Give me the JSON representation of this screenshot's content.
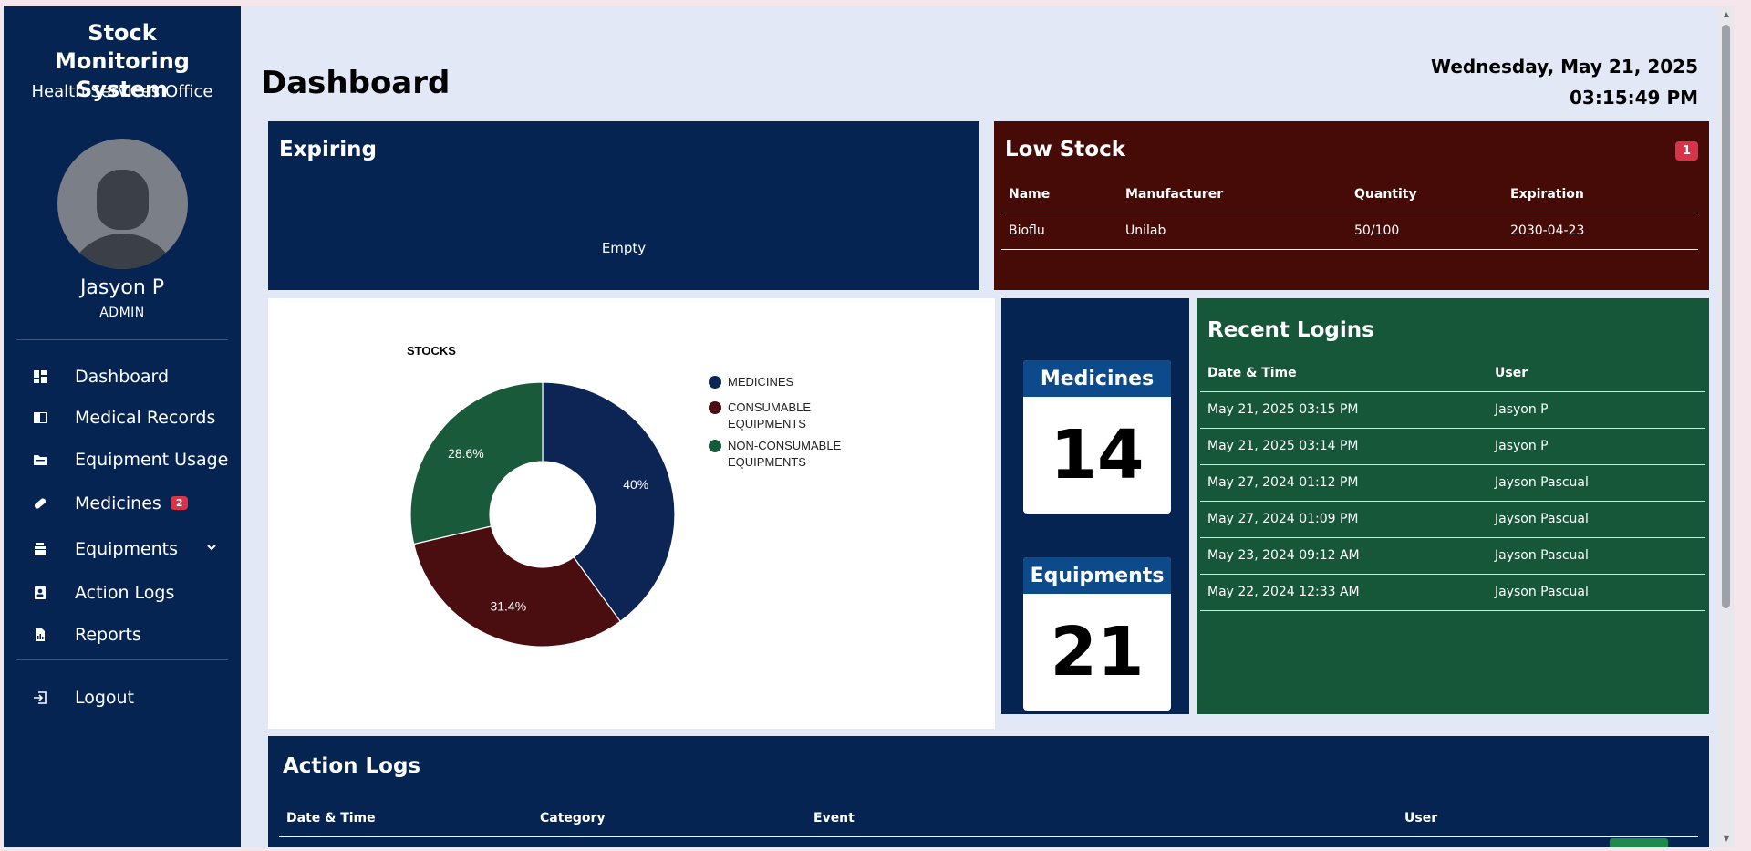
{
  "sidebar": {
    "title": "Stock Monitoring System",
    "subtitle": "Health Services Office",
    "user_name": "Jasyon P",
    "user_role": "ADMIN",
    "nav": [
      {
        "label": "Dashboard",
        "icon": "grid-icon"
      },
      {
        "label": "Medical Records",
        "icon": "book-icon"
      },
      {
        "label": "Equipment Usage",
        "icon": "folder-icon"
      },
      {
        "label": "Medicines",
        "icon": "pill-icon",
        "badge": "2"
      },
      {
        "label": "Equipments",
        "icon": "stack-icon"
      },
      {
        "label": "Action Logs",
        "icon": "contact-card-icon"
      },
      {
        "label": "Reports",
        "icon": "report-icon"
      },
      {
        "label": "Logout",
        "icon": "logout-icon"
      }
    ]
  },
  "header": {
    "title": "Dashboard",
    "date": "Wednesday, May 21, 2025",
    "time": "03:15:49 PM"
  },
  "expiring": {
    "title": "Expiring",
    "empty_text": "Empty"
  },
  "low_stock": {
    "title": "Low Stock",
    "count": "1",
    "columns": [
      "Name",
      "Manufacturer",
      "Quantity",
      "Expiration"
    ],
    "rows": [
      [
        "Bioflu",
        "Unilab",
        "50/100",
        "2030-04-23"
      ]
    ]
  },
  "stats": {
    "medicines_label": "Medicines",
    "medicines_count": "14",
    "equipments_label": "Equipments",
    "equipments_count": "21"
  },
  "recent_logins": {
    "title": "Recent Logins",
    "columns": [
      "Date & Time",
      "User"
    ],
    "rows": [
      [
        "May 21, 2025 03:15 PM",
        "Jasyon P"
      ],
      [
        "May 21, 2025 03:14 PM",
        "Jasyon P"
      ],
      [
        "May 27, 2024 01:12 PM",
        "Jayson Pascual"
      ],
      [
        "May 27, 2024 01:09 PM",
        "Jayson Pascual"
      ],
      [
        "May 23, 2024 09:12 AM",
        "Jayson Pascual"
      ],
      [
        "May 22, 2024 12:33 AM",
        "Jayson Pascual"
      ]
    ]
  },
  "action_logs": {
    "title": "Action Logs",
    "columns": [
      "Date & Time",
      "Category",
      "Event",
      "User"
    ]
  },
  "colors": {
    "navy": "#062451",
    "maroon": "#460a07",
    "green": "#16573a",
    "accent_blue": "#0c4a8c",
    "badge_red": "#d9334a"
  },
  "chart_data": {
    "type": "pie",
    "title": "STOCKS",
    "donut": true,
    "legend_position": "right",
    "slices": [
      {
        "label": "MEDICINES",
        "value": 40,
        "display": "40%",
        "color": "#0d2554"
      },
      {
        "label": "CONSUMABLE EQUIPMENTS",
        "value": 31.4,
        "display": "31.4%",
        "color": "#4a0e10"
      },
      {
        "label": "NON-CONSUMABLE EQUIPMENTS",
        "value": 28.6,
        "display": "28.6%",
        "color": "#185a3a"
      }
    ]
  }
}
